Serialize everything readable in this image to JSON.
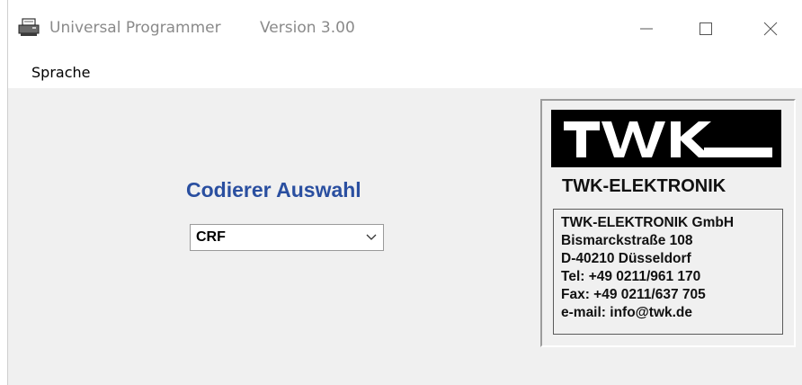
{
  "window": {
    "title": "Universal Programmer",
    "version": "Version  3.00",
    "icons": {
      "app": "printer-icon",
      "minimize": "minimize-icon",
      "maximize": "maximize-icon",
      "close": "close-icon"
    }
  },
  "menu": {
    "items": [
      {
        "label": "Sprache"
      }
    ]
  },
  "main": {
    "heading": "Codierer Auswahl",
    "encoder_select": {
      "value": "CRF",
      "icon": "chevron-down-icon"
    },
    "heading_color": "#2a4fa0"
  },
  "info": {
    "logo_text": "TWK",
    "company": "TWK-ELEKTRONIK",
    "address": [
      "TWK-ELEKTRONIK GmbH",
      "Bismarckstraße 108",
      "D-40210 Düsseldorf",
      "Tel:  +49 0211/961 170",
      "Fax: +49 0211/637 705",
      "e-mail: info@twk.de"
    ]
  }
}
